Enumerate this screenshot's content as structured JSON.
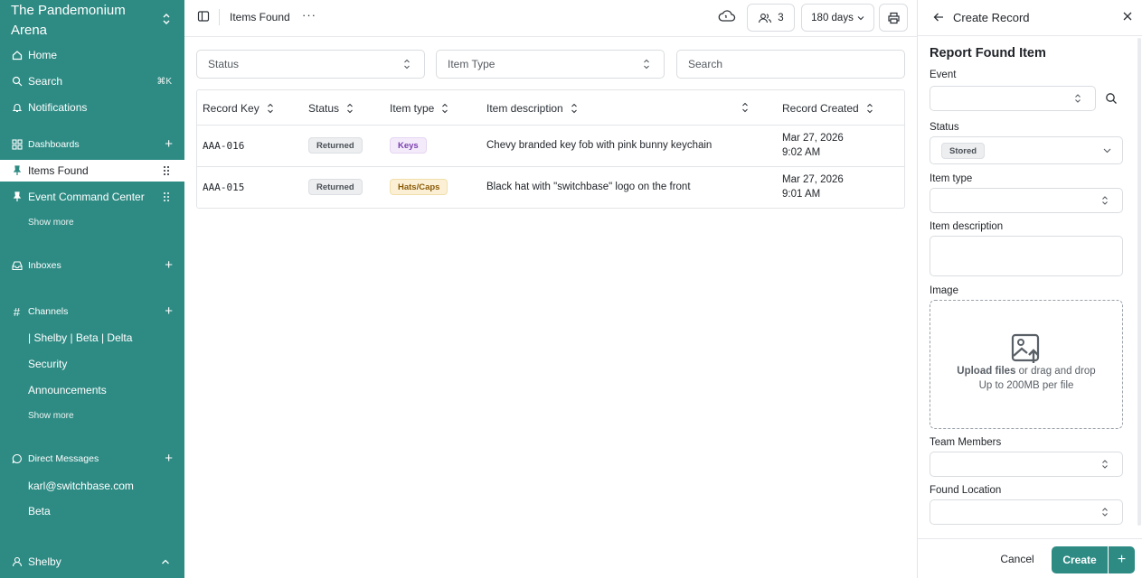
{
  "sidebar": {
    "workspace": "The Pandemonium Arena",
    "home": "Home",
    "search": "Search",
    "search_shortcut": "⌘K",
    "notifications": "Notifications",
    "dashboards": "Dashboards",
    "items_found": "Items Found",
    "event_command_center": "Event Command Center",
    "show_more_1": "Show more",
    "inboxes": "Inboxes",
    "channels": "Channels",
    "channel_items": [
      "| Shelby | Beta | Delta",
      "Security",
      "Announcements"
    ],
    "show_more_2": "Show more",
    "direct_messages": "Direct Messages",
    "dm_items": [
      "karl@switchbase.com",
      "Beta"
    ],
    "user": "Shelby"
  },
  "topbar": {
    "title": "Items Found",
    "members_count": "3",
    "range": "180 days"
  },
  "filters": {
    "status": "Status",
    "item_type": "Item Type",
    "search_placeholder": "Search"
  },
  "table": {
    "headers": [
      "Record Key",
      "Status",
      "Item type",
      "Item description",
      "Record Created"
    ],
    "rows": [
      {
        "key": "AAA-016",
        "status": "Returned",
        "type": "Keys",
        "description": "Chevy branded key fob with pink bunny keychain",
        "date": "Mar 27, 2026",
        "time": "9:02 AM"
      },
      {
        "key": "AAA-015",
        "status": "Returned",
        "type": "Hats/Caps",
        "description": "Black hat with \"switchbase\" logo on the front",
        "date": "Mar 27, 2026",
        "time": "9:01 AM"
      }
    ]
  },
  "panel": {
    "title": "Create Record",
    "form_title": "Report Found Item",
    "labels": {
      "event": "Event",
      "status": "Status",
      "item_type": "Item type",
      "item_description": "Item description",
      "image": "Image",
      "team_members": "Team Members",
      "found_location": "Found Location"
    },
    "status_value": "Stored",
    "upload_strong": "Upload files",
    "upload_rest": " or drag and drop",
    "upload_limit": "Up to 200MB per file",
    "cancel": "Cancel",
    "create": "Create",
    "plus": "+"
  },
  "colors": {
    "sidebar_bg": "#2e8b84",
    "accent": "#2e8b84"
  }
}
